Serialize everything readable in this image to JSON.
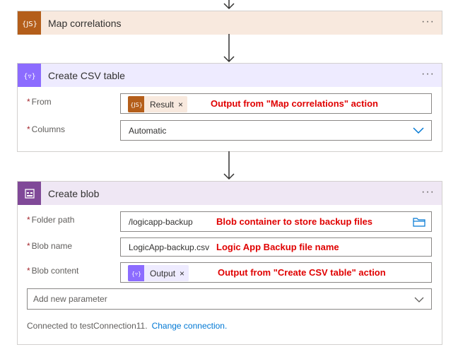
{
  "steps": {
    "map_correlations": {
      "title": "Map correlations",
      "icon": "js-script-icon",
      "color": "#b45e1a",
      "header_bg": "#f8e9de"
    },
    "create_csv_table": {
      "title": "Create CSV table",
      "icon": "data-operations-icon",
      "color": "#8c6cff",
      "header_bg": "#eeebff",
      "from_label": "From",
      "from_token": "Result",
      "columns_label": "Columns",
      "columns_value": "Automatic"
    },
    "create_blob": {
      "title": "Create blob",
      "icon": "blob-storage-icon",
      "color": "#804998",
      "header_bg": "#efe7f4",
      "folder_label": "Folder path",
      "folder_value": "/logicapp-backup",
      "blob_name_label": "Blob name",
      "blob_name_value": "LogicApp-backup.csv",
      "blob_content_label": "Blob content",
      "blob_content_token": "Output",
      "add_param_placeholder": "Add new parameter",
      "connection_text": "Connected to testConnection11.",
      "change_connection": "Change connection."
    }
  },
  "more_label": "···",
  "required_marker": "*",
  "remove_token": "×",
  "annotations": {
    "from": "Output from \"Map correlations\" action",
    "folder": "Blob container to store backup files",
    "blob_name": "Logic App Backup file name",
    "blob_content": "Output from \"Create CSV table\" action"
  },
  "colors": {
    "annotation": "#e00000",
    "link": "#0078d4",
    "required": "#a4262c"
  }
}
